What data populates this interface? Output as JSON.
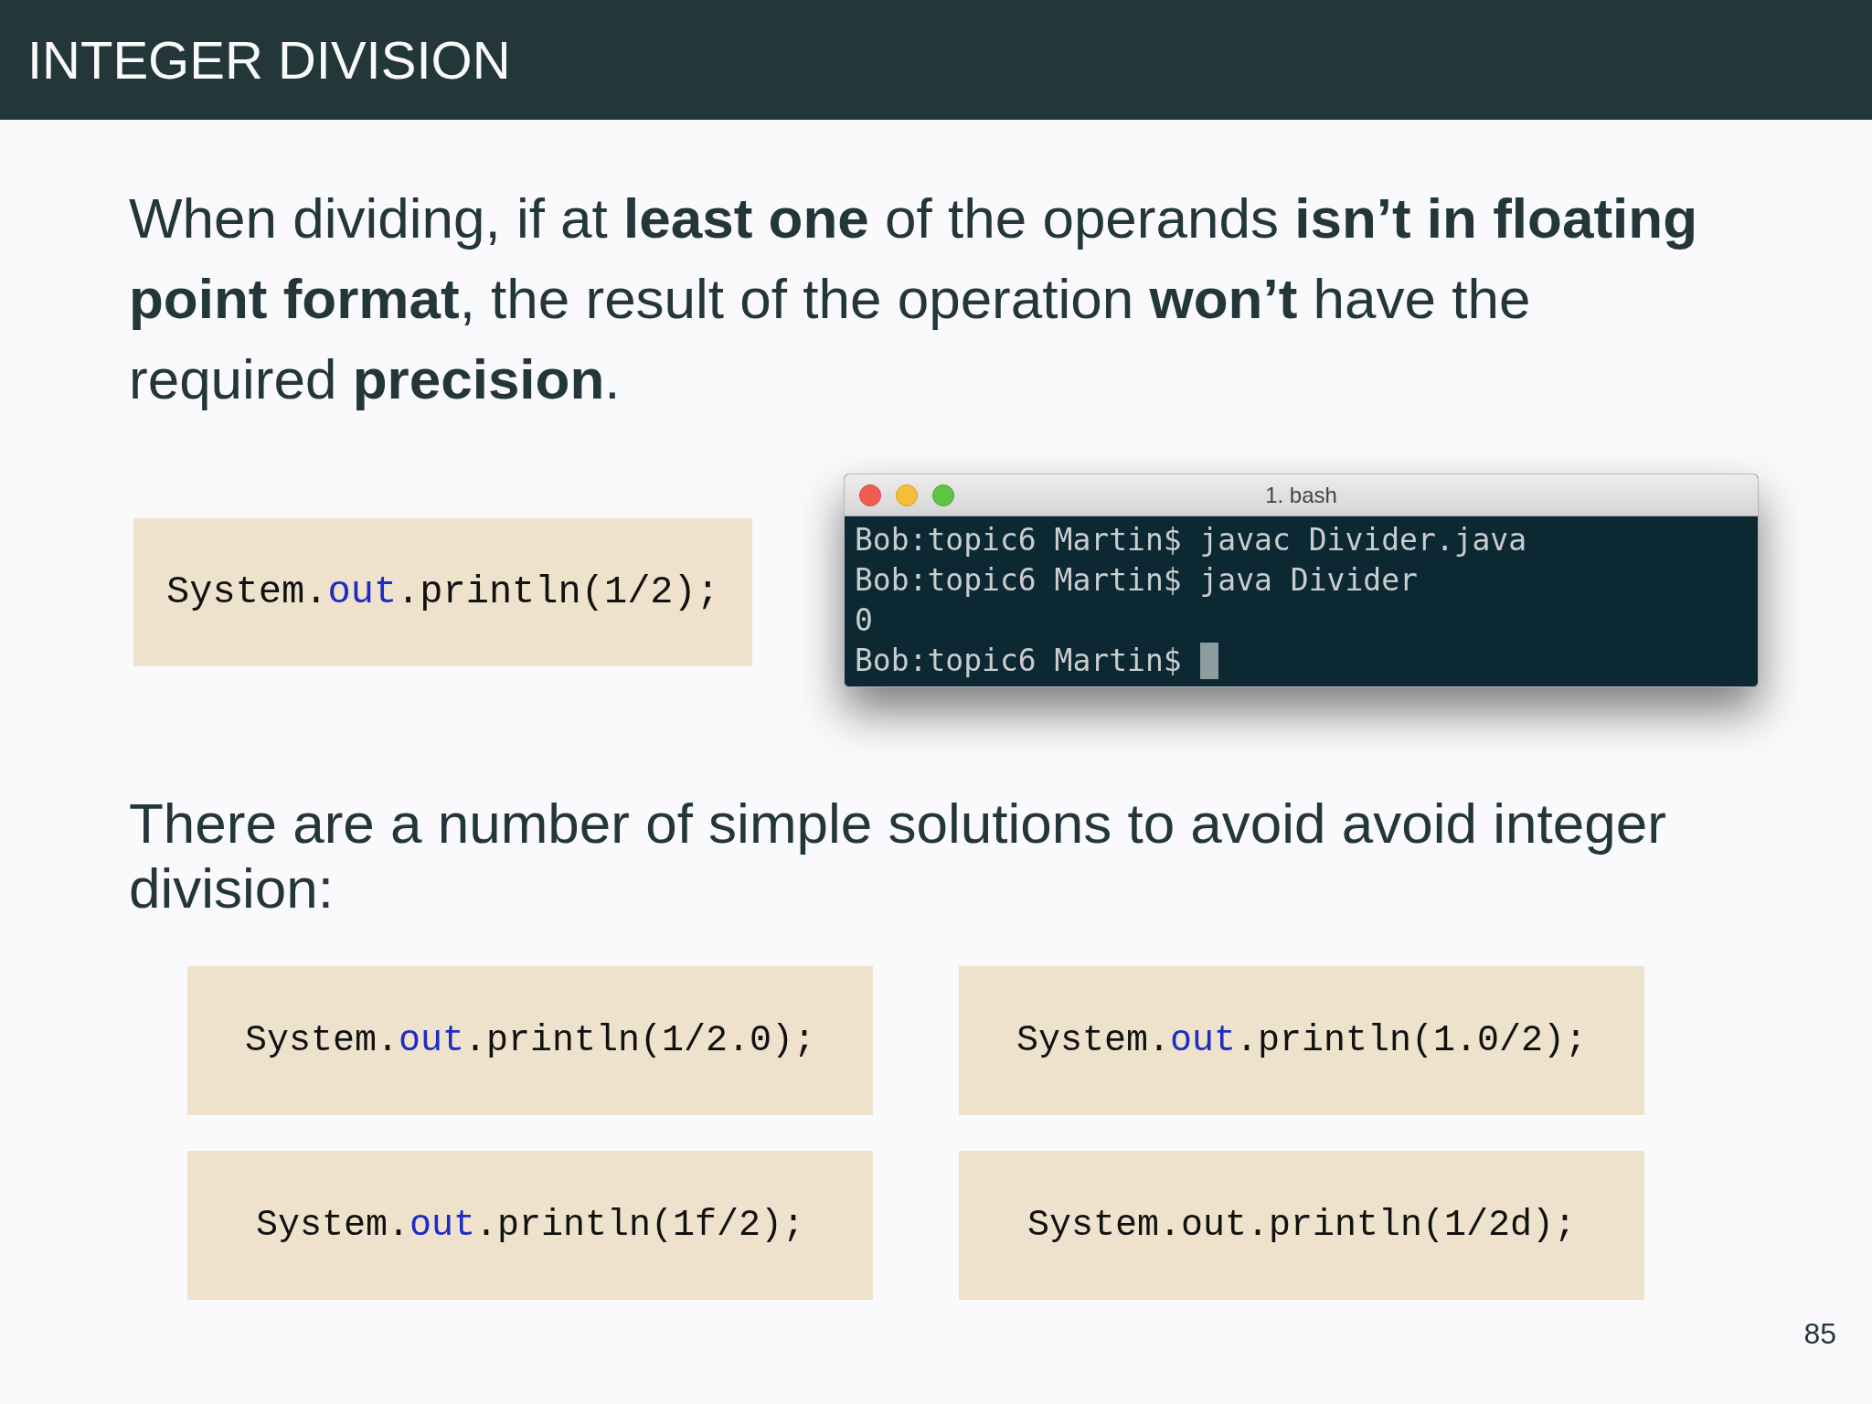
{
  "header": {
    "title": "INTEGER DIVISION"
  },
  "intro": {
    "text": "When dividing, if at **least one** of the operands **isn’t in floating point format**, the result of the operation **won’t** have the required **precision**."
  },
  "example": {
    "code": [
      {
        "text": "System.",
        "kind": "plain"
      },
      {
        "text": "out",
        "kind": "field"
      },
      {
        "text": ".println(1/2);",
        "kind": "plain"
      }
    ]
  },
  "terminal": {
    "title": "1. bash",
    "lines": [
      {
        "text": "Bob:topic6 Martin$ javac Divider.java",
        "cursor": false
      },
      {
        "text": "Bob:topic6 Martin$ java Divider",
        "cursor": false
      },
      {
        "text": "0",
        "cursor": false
      },
      {
        "text": "Bob:topic6 Martin$",
        "cursor": true
      }
    ]
  },
  "solutions": {
    "text": "There are a number of simple solutions to avoid avoid integer division:"
  },
  "snippets": [
    {
      "code": [
        {
          "text": "System.",
          "kind": "plain"
        },
        {
          "text": "out",
          "kind": "field"
        },
        {
          "text": ".println(1/2.0);",
          "kind": "plain"
        }
      ]
    },
    {
      "code": [
        {
          "text": "System.",
          "kind": "plain"
        },
        {
          "text": "out",
          "kind": "field"
        },
        {
          "text": ".println(1.0/2);",
          "kind": "plain"
        }
      ]
    },
    {
      "code": [
        {
          "text": "System.",
          "kind": "plain"
        },
        {
          "text": "out",
          "kind": "field"
        },
        {
          "text": ".println(1f/2);",
          "kind": "plain"
        }
      ]
    },
    {
      "code": [
        {
          "text": "System.out.println(1/2d);",
          "kind": "plain"
        }
      ]
    }
  ],
  "page_number": "85"
}
